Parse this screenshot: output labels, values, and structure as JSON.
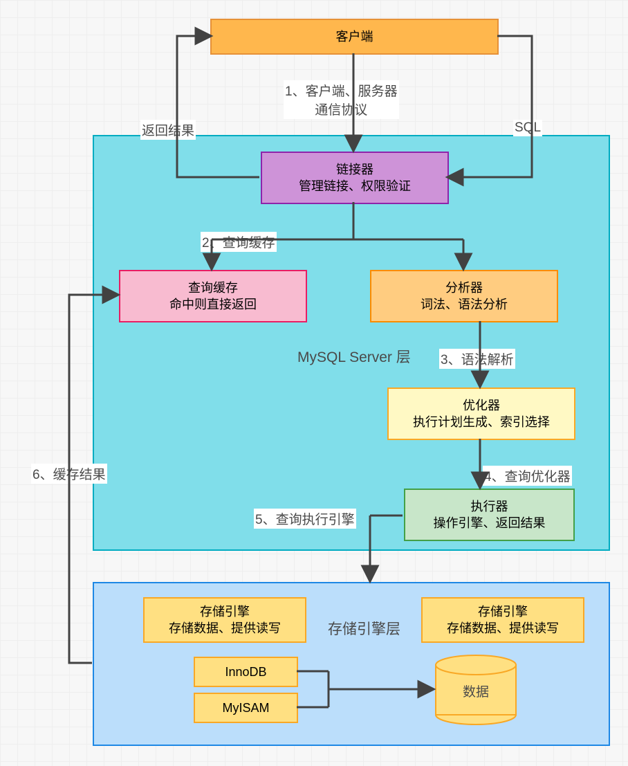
{
  "nodes": {
    "client": {
      "title": "客户端"
    },
    "connector": {
      "title": "链接器",
      "sub": "管理链接、权限验证"
    },
    "cache": {
      "title": "查询缓存",
      "sub": "命中则直接返回"
    },
    "analyzer": {
      "title": "分析器",
      "sub": "词法、语法分析"
    },
    "optimizer": {
      "title": "优化器",
      "sub": "执行计划生成、索引选择"
    },
    "executor": {
      "title": "执行器",
      "sub": "操作引擎、返回结果"
    },
    "engine1": {
      "title": "存储引擎",
      "sub": "存储数据、提供读写"
    },
    "engine2": {
      "title": "存储引擎",
      "sub": "存储数据、提供读写"
    },
    "innodb": "InnoDB",
    "myisam": "MyISAM",
    "data": "数据"
  },
  "labels": {
    "serverLayer": "MySQL Server 层",
    "storageLayer": "存储引擎层",
    "l1": "1、客户端、服务器\n通信协议",
    "l2": "2、查询缓存",
    "l3": "3、语法解析",
    "l4": "4、查询优化器",
    "l5": "5、查询执行引擎",
    "l6": "6、缓存结果",
    "lReturn": "返回结果",
    "lSQL": "SQL"
  }
}
